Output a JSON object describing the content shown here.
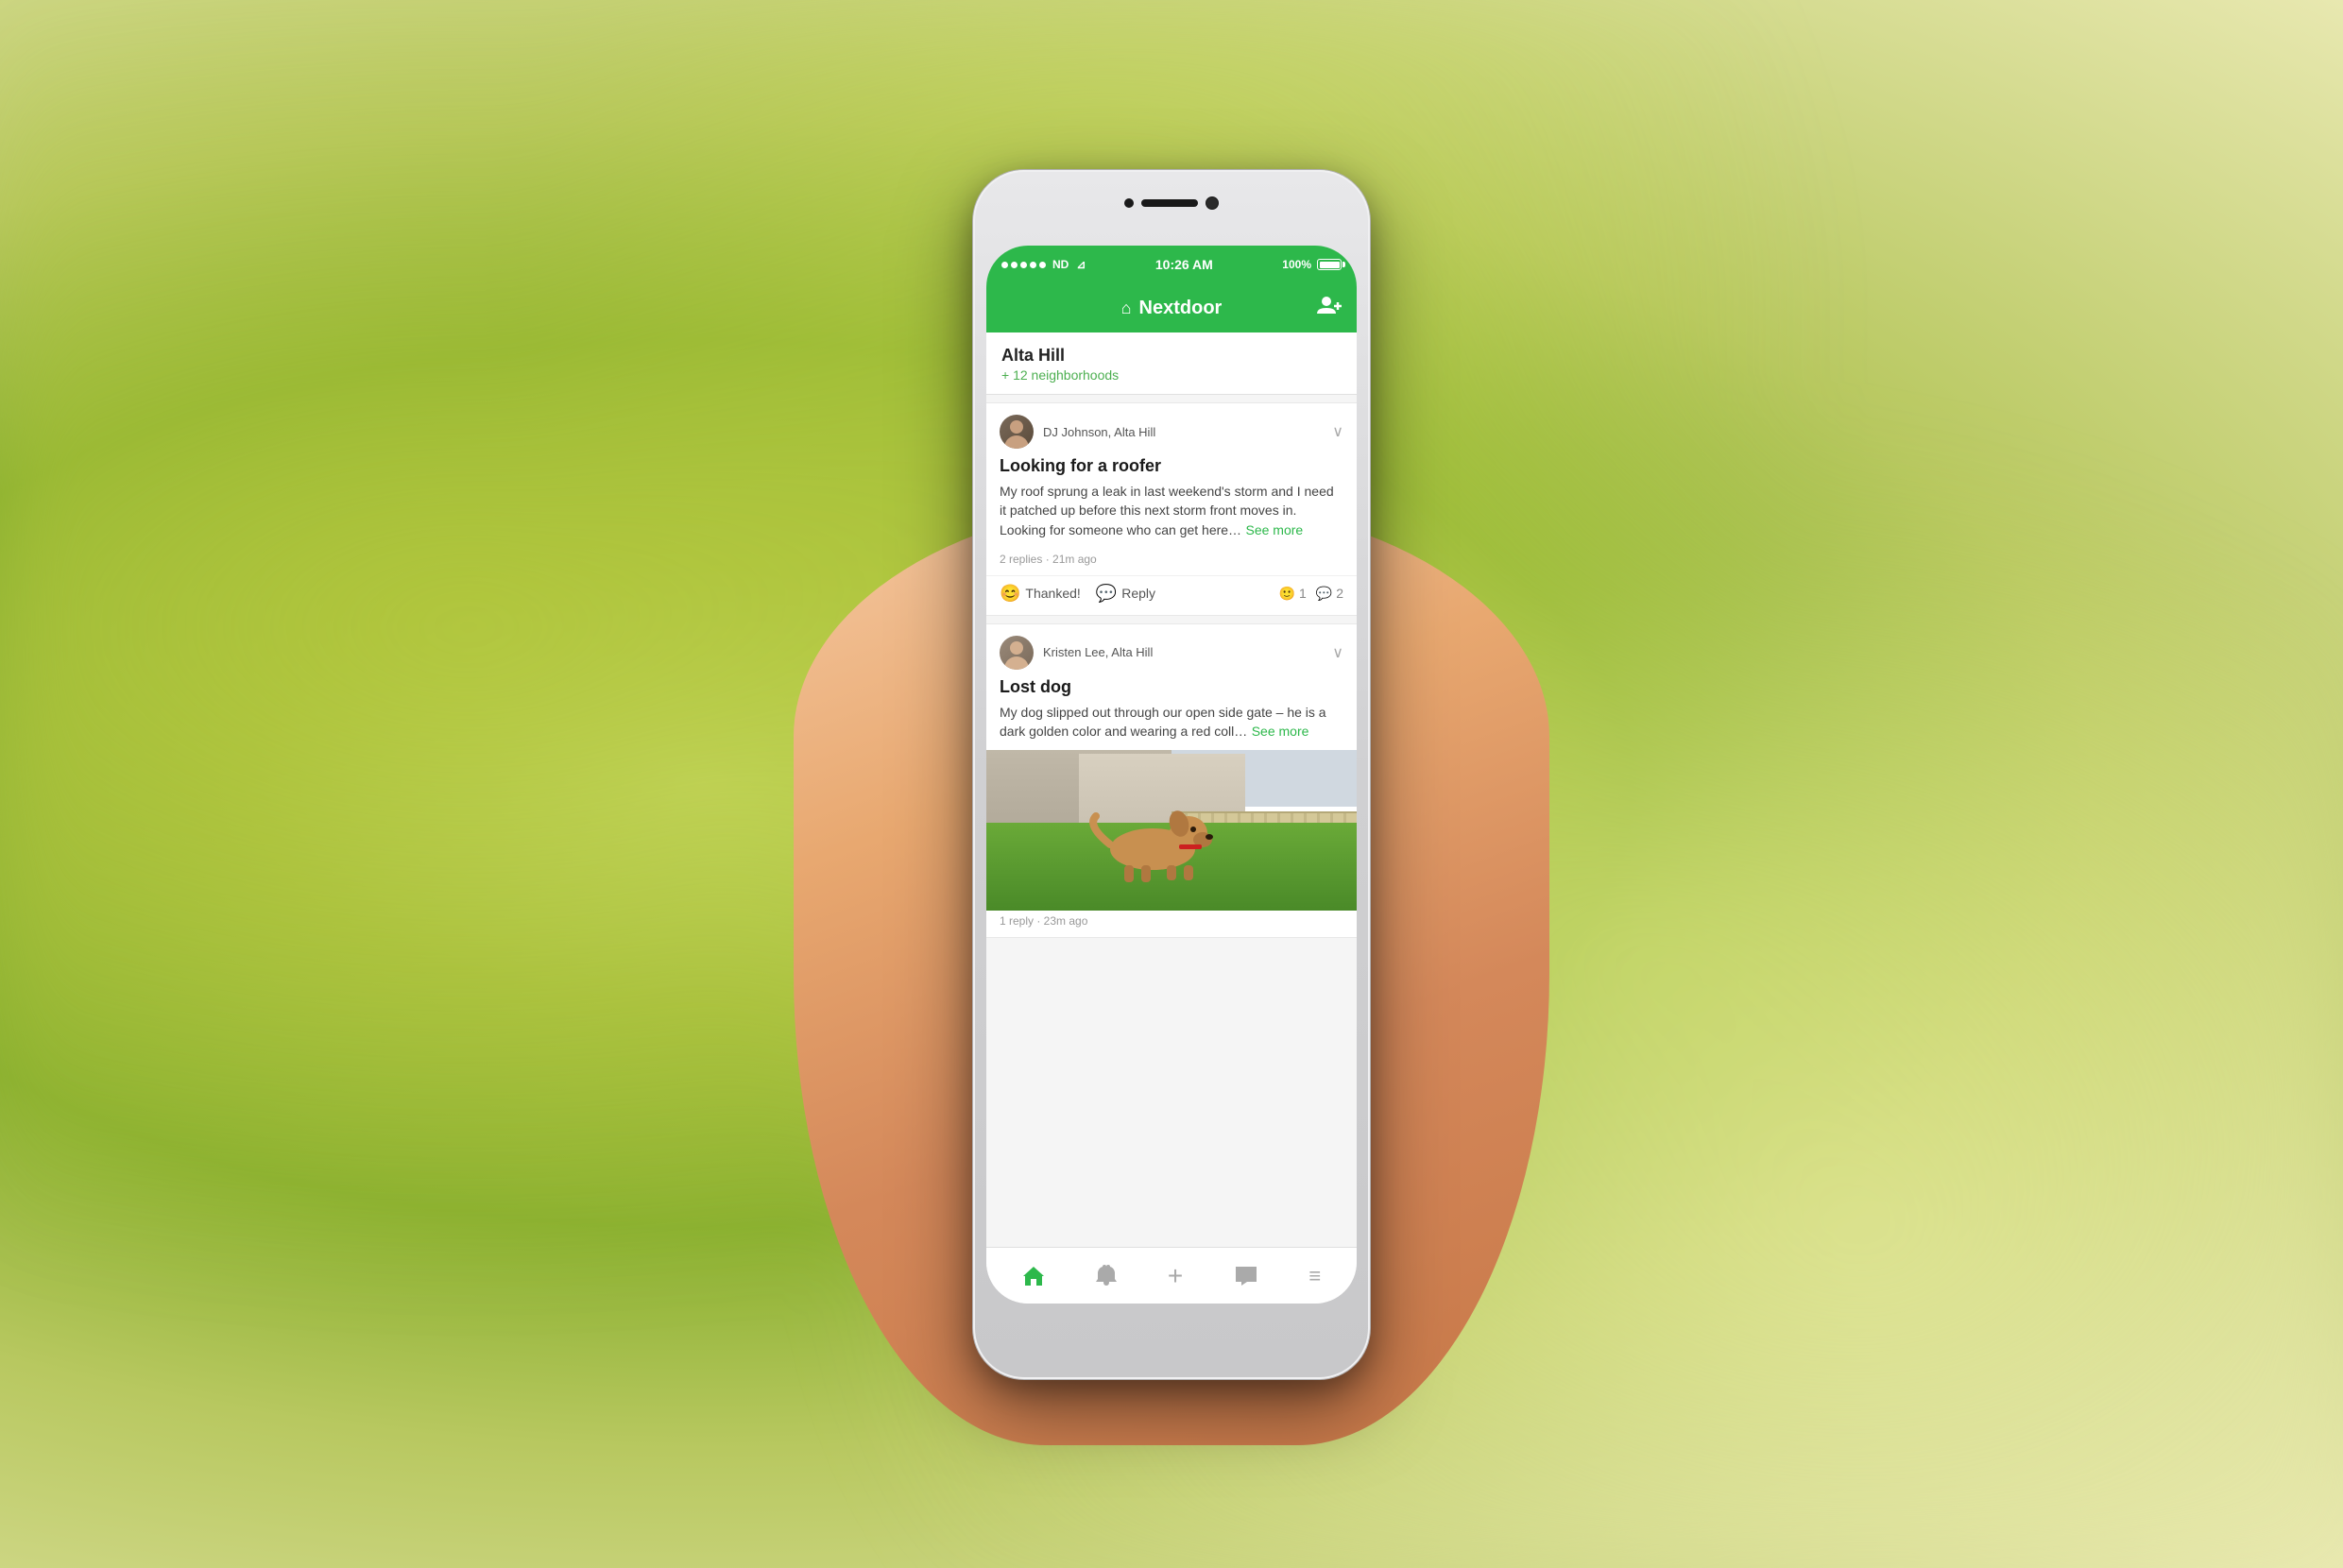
{
  "background": {
    "color": "#a8c040"
  },
  "phone": {
    "status_bar": {
      "signal": "●●●●●",
      "carrier": "ND",
      "wifi": "WiFi",
      "time": "10:26 AM",
      "battery_percent": "100%"
    },
    "nav": {
      "title": "Nextdoor",
      "add_friend_icon": "add-friend"
    },
    "location_header": {
      "name": "Alta Hill",
      "sub": "+ 12 neighborhoods"
    },
    "posts": [
      {
        "id": "post1",
        "author": "DJ Johnson, Alta Hill",
        "title": "Looking for a roofer",
        "body": "My roof sprung a leak in last weekend's storm and I need it patched up before this next storm front moves in. Looking for someone who can get here…",
        "see_more": "See more",
        "meta": "2 replies · 21m ago",
        "actions": {
          "thank": "Thanked!",
          "reply": "Reply"
        },
        "counts": {
          "reactions": "1",
          "comments": "2"
        }
      },
      {
        "id": "post2",
        "author": "Kristen Lee, Alta Hill",
        "title": "Lost dog",
        "body": "My dog slipped out through our open side gate – he is a dark golden color and wearing a red coll…",
        "see_more": "See more",
        "meta": "1 reply · 23m ago",
        "has_image": true
      }
    ],
    "tab_bar": {
      "tabs": [
        {
          "label": "home",
          "icon": "⌂",
          "active": true
        },
        {
          "label": "notifications",
          "icon": "🔔",
          "active": false
        },
        {
          "label": "compose",
          "icon": "+",
          "active": false
        },
        {
          "label": "messages",
          "icon": "💬",
          "active": false
        },
        {
          "label": "menu",
          "icon": "≡",
          "active": false
        }
      ]
    }
  }
}
